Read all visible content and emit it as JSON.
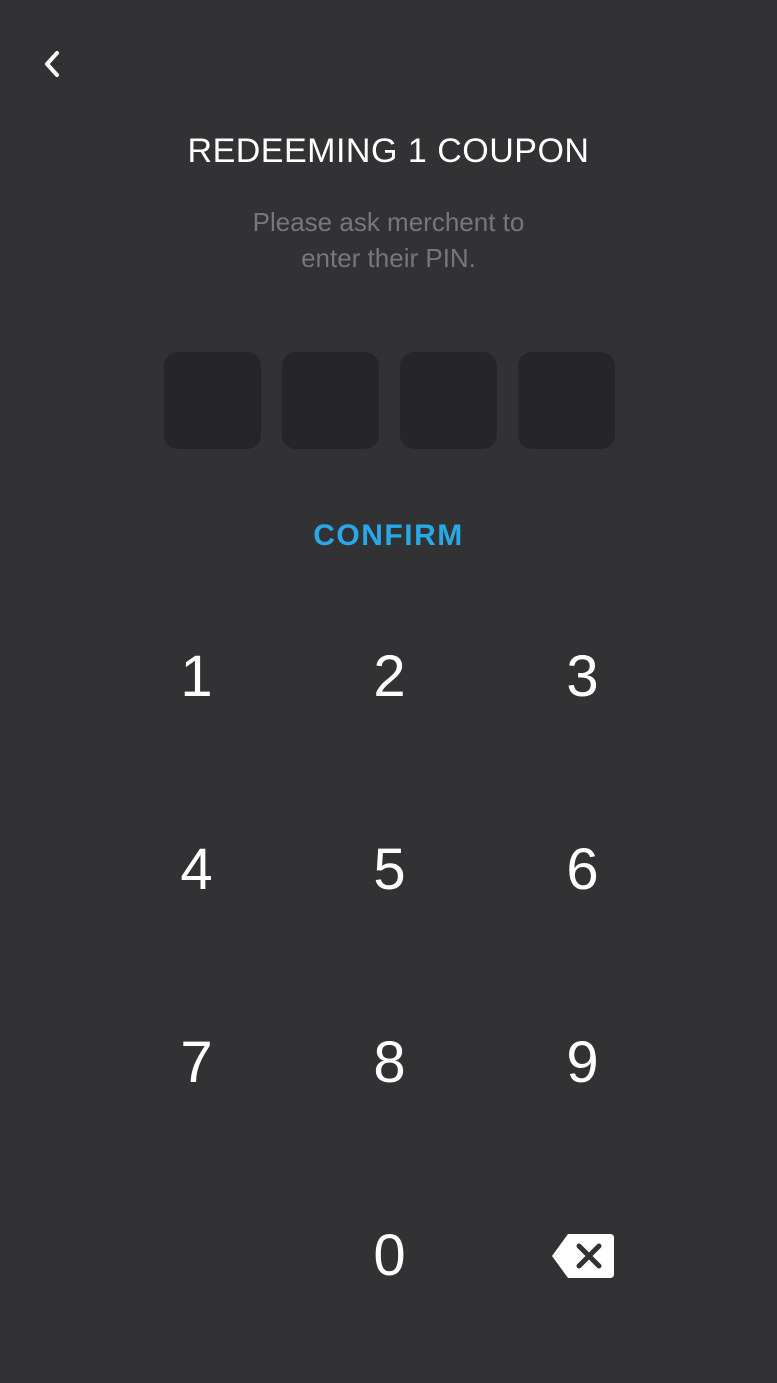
{
  "header": {
    "back_icon": "chevron-left-icon",
    "title": "REDEEMING 1 COUPON",
    "subtitle_line1": "Please ask merchent to",
    "subtitle_line2": "enter their PIN."
  },
  "pin": {
    "length": 4,
    "digits": [
      "",
      "",
      "",
      ""
    ]
  },
  "confirm_label": "CONFIRM",
  "keypad": {
    "k1": "1",
    "k2": "2",
    "k3": "3",
    "k4": "4",
    "k5": "5",
    "k6": "6",
    "k7": "7",
    "k8": "8",
    "k9": "9",
    "k0": "0",
    "backspace_icon": "backspace-icon"
  },
  "colors": {
    "background": "#323234",
    "pin_box": "#262628",
    "accent": "#27a9e8",
    "subtitle": "#77777b"
  }
}
